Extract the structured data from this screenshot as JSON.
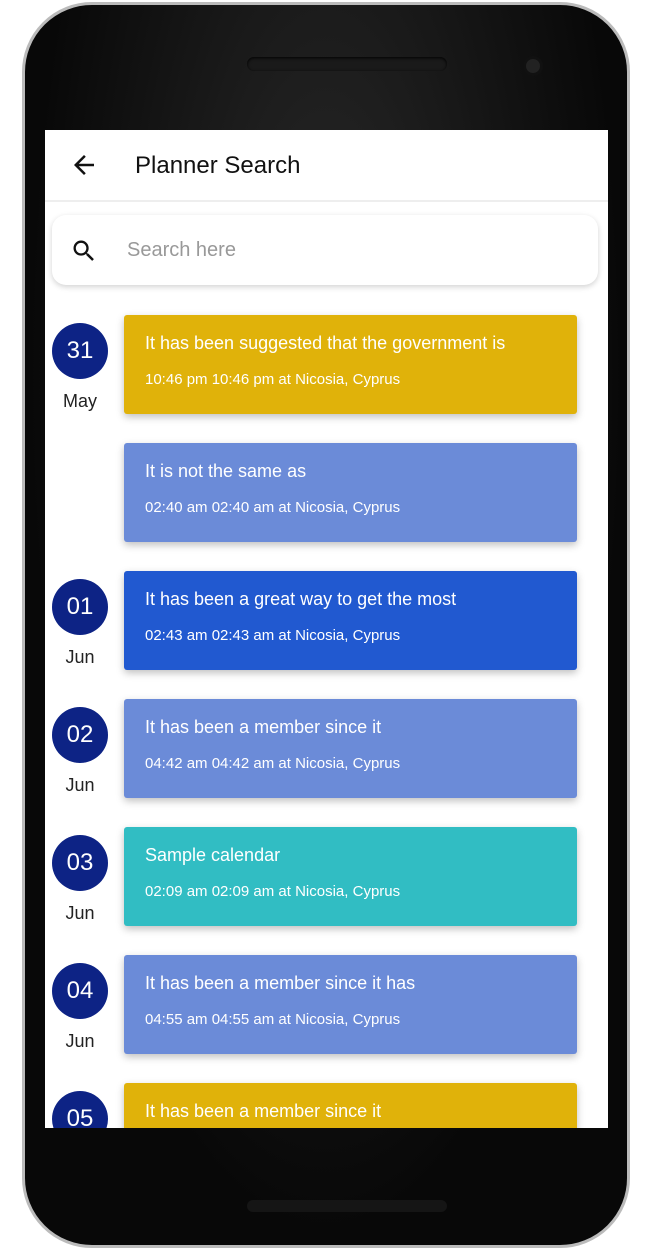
{
  "header": {
    "title": "Planner Search",
    "back_icon": "arrow-left-icon"
  },
  "search": {
    "placeholder": "Search here",
    "value": "",
    "icon": "search-icon"
  },
  "colors": {
    "date_circle": "#0d2385",
    "yellow": "#e0b20a",
    "light_blue": "#6b8bd8",
    "blue": "#2159d0",
    "teal": "#31bdc3"
  },
  "events": [
    {
      "day": "31",
      "month": "May",
      "title": "It has been suggested that the government is",
      "meta": "10:46 pm  10:46 pm at Nicosia, Cyprus",
      "color": "#e0b20a"
    },
    {
      "day": "",
      "month": "",
      "title": "It is not the same as",
      "meta": "02:40 am  02:40 am at Nicosia, Cyprus",
      "color": "#6b8bd8"
    },
    {
      "day": "01",
      "month": "Jun",
      "title": "It has been a great way to get the most",
      "meta": "02:43 am  02:43 am at Nicosia, Cyprus",
      "color": "#2159d0"
    },
    {
      "day": "02",
      "month": "Jun",
      "title": "It has been a member since it",
      "meta": "04:42 am  04:42 am at Nicosia, Cyprus",
      "color": "#6b8bd8"
    },
    {
      "day": "03",
      "month": "Jun",
      "title": "Sample calendar",
      "meta": "02:09 am  02:09 am at Nicosia, Cyprus",
      "color": "#31bdc3"
    },
    {
      "day": "04",
      "month": "Jun",
      "title": "It has been a member since it has",
      "meta": "04:55 am  04:55 am at Nicosia, Cyprus",
      "color": "#6b8bd8"
    },
    {
      "day": "05",
      "month": "",
      "title": "It has been a member since it",
      "meta": "",
      "color": "#e0b20a"
    }
  ]
}
